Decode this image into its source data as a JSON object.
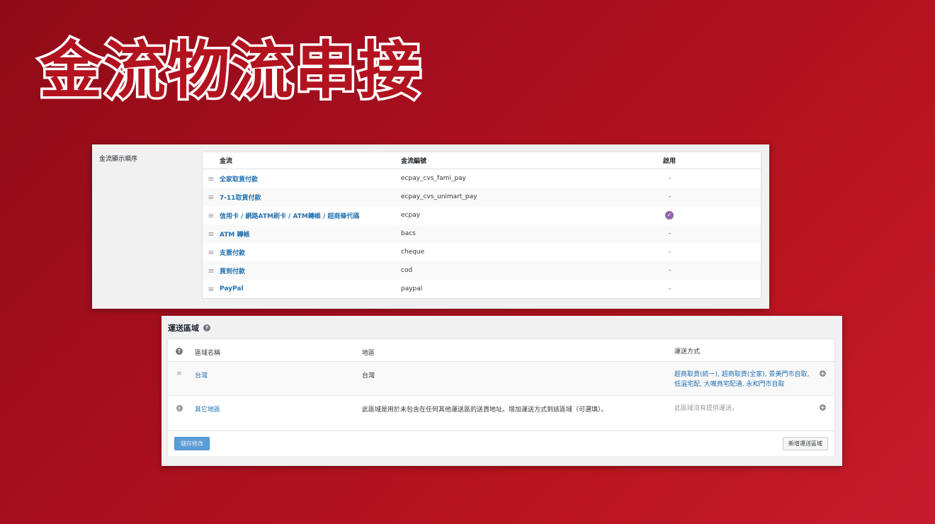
{
  "headline": "金流物流串接",
  "payments": {
    "section_label": "金流顯示順序",
    "columns": [
      "金流",
      "金流編號",
      "啟用"
    ],
    "rows": [
      {
        "name": "全家取貨付款",
        "id": "ecpay_cvs_fami_pay",
        "enabled": "-"
      },
      {
        "name": "7-11取貨付款",
        "id": "ecpay_cvs_unimart_pay",
        "enabled": "-"
      },
      {
        "name": "信用卡 / 網路ATM刷卡 / ATM轉帳 / 超商條代碼",
        "id": "ecpay",
        "enabled": "✓"
      },
      {
        "name": "ATM 轉帳",
        "id": "bacs",
        "enabled": "-"
      },
      {
        "name": "支票付款",
        "id": "cheque",
        "enabled": "-"
      },
      {
        "name": "貨到付款",
        "id": "cod",
        "enabled": "-"
      },
      {
        "name": "PayPal",
        "id": "paypal",
        "enabled": "-"
      }
    ]
  },
  "shipping": {
    "title": "運送區域",
    "columns": [
      "區域名稱",
      "地區",
      "運送方式"
    ],
    "zones": [
      {
        "name": "台灣",
        "region": "台灣",
        "methods": "超商取貨(統一), 超商取貨(全家), 景美門市自取, 低溫宅配, 大嘴鳥宅配通, 永和門市自取"
      },
      {
        "name": "其它地區",
        "region": "此區域是用於未包含在任何其他運送區的送貨地址。增加運送方式到該區域（可選填）。",
        "methods": "此區域沒有提供運送。"
      }
    ],
    "save_label": "儲存修改",
    "add_zone_label": "新增運送區域"
  },
  "colors": {
    "accent": "#2271b1",
    "enabled_check": "#9664a8",
    "background": "#a80f1f"
  }
}
